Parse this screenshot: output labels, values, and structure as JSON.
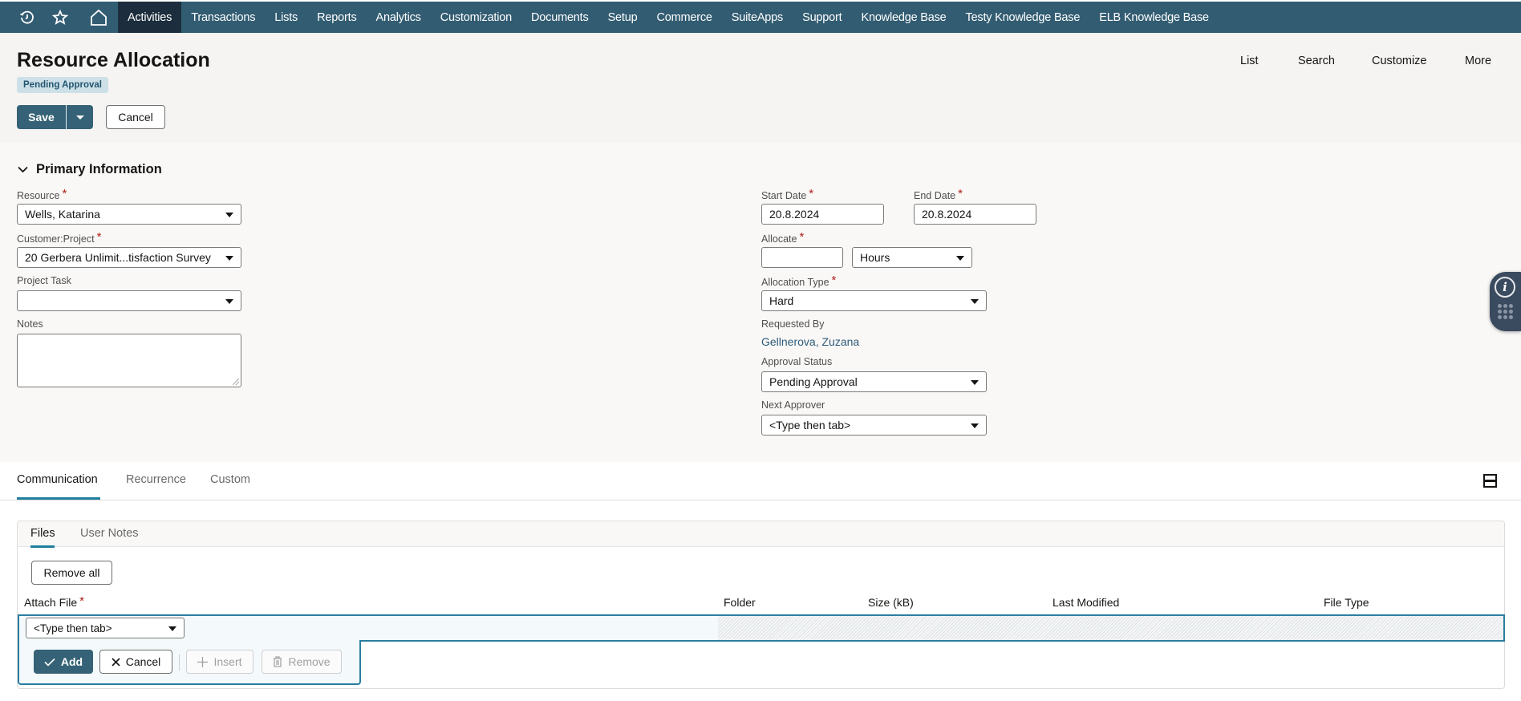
{
  "nav": {
    "icons": [
      "recent-icon",
      "star-icon",
      "home-icon"
    ],
    "items": [
      {
        "label": "Activities",
        "active": true
      },
      {
        "label": "Transactions"
      },
      {
        "label": "Lists"
      },
      {
        "label": "Reports"
      },
      {
        "label": "Analytics"
      },
      {
        "label": "Customization"
      },
      {
        "label": "Documents"
      },
      {
        "label": "Setup"
      },
      {
        "label": "Commerce"
      },
      {
        "label": "SuiteApps"
      },
      {
        "label": "Support"
      },
      {
        "label": "Knowledge Base"
      },
      {
        "label": "Testy Knowledge Base"
      },
      {
        "label": "ELB Knowledge Base"
      }
    ]
  },
  "header": {
    "title": "Resource Allocation",
    "status": "Pending Approval",
    "save_label": "Save",
    "cancel_label": "Cancel",
    "links": [
      "List",
      "Search",
      "Customize",
      "More"
    ]
  },
  "primary": {
    "section_title": "Primary Information",
    "resource": {
      "label": "Resource",
      "value": "Wells, Katarina"
    },
    "customer_project": {
      "label": "Customer:Project",
      "value": "20 Gerbera Unlimit...tisfaction Survey"
    },
    "project_task": {
      "label": "Project Task",
      "value": ""
    },
    "notes": {
      "label": "Notes",
      "value": ""
    },
    "start_date": {
      "label": "Start Date",
      "value": "20.8.2024"
    },
    "end_date": {
      "label": "End Date",
      "value": "20.8.2024"
    },
    "allocate": {
      "label": "Allocate",
      "value": "",
      "unit": "Hours"
    },
    "allocation_type": {
      "label": "Allocation Type",
      "value": "Hard"
    },
    "requested_by": {
      "label": "Requested By",
      "value": "Gellnerova, Zuzana"
    },
    "approval_status": {
      "label": "Approval Status",
      "value": "Pending Approval"
    },
    "next_approver": {
      "label": "Next Approver",
      "value": "<Type then tab>"
    }
  },
  "tabs": {
    "items": [
      {
        "label": "Communication",
        "active": true
      },
      {
        "label": "Recurrence"
      },
      {
        "label": "Custom"
      }
    ]
  },
  "files": {
    "subtabs": [
      {
        "label": "Files",
        "active": true
      },
      {
        "label": "User Notes"
      }
    ],
    "remove_all_label": "Remove all",
    "columns": [
      "Attach File",
      "Folder",
      "Size (kB)",
      "Last Modified",
      "File Type"
    ],
    "attach_placeholder": "<Type then tab>",
    "actions": {
      "add": "Add",
      "cancel": "Cancel",
      "insert": "Insert",
      "remove": "Remove"
    }
  },
  "colors": {
    "nav_bg": "#325c72",
    "nav_active": "#1c2e3d",
    "primary_button": "#356276",
    "accent": "#227e9e",
    "required": "#b0201c",
    "link": "#2d5a7b"
  }
}
